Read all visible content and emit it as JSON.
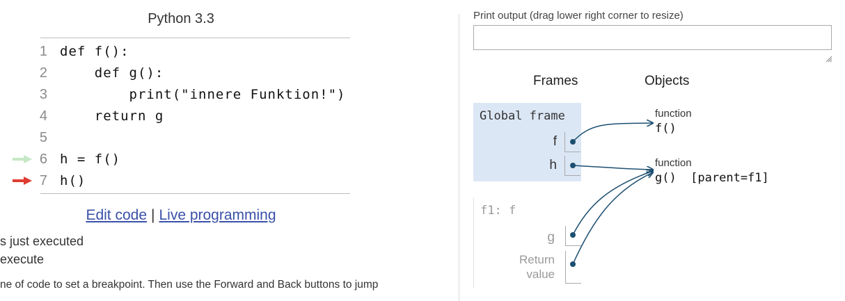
{
  "language_title": "Python 3.3",
  "code_lines": [
    {
      "num": "1",
      "text": "def f():"
    },
    {
      "num": "2",
      "text": "    def g():"
    },
    {
      "num": "3",
      "text": "        print(\"innere Funktion!\")"
    },
    {
      "num": "4",
      "text": "    return g"
    },
    {
      "num": "5",
      "text": ""
    },
    {
      "num": "6",
      "text": "h = f()"
    },
    {
      "num": "7",
      "text": "h()"
    }
  ],
  "markers": {
    "prev_line_color": "#c6e8c6",
    "next_line_color": "#e03c31"
  },
  "links": {
    "edit_code": "Edit code",
    "separator": "|",
    "live_programming": "Live programming"
  },
  "legend": {
    "just_executed": "s just executed",
    "to_execute": "execute"
  },
  "hint": "ne of code to set a breakpoint. Then use the Forward and Back buttons to jump",
  "print_output": {
    "label": "Print output (drag lower right corner to resize)",
    "value": ""
  },
  "viz": {
    "frames_header": "Frames",
    "objects_header": "Objects",
    "global_frame": {
      "title": "Global frame",
      "vars": [
        {
          "name": "f"
        },
        {
          "name": "h"
        }
      ]
    },
    "f1_frame": {
      "title": "f1: f",
      "vars": [
        {
          "name": "g"
        },
        {
          "name": "Return\nvalue"
        }
      ]
    },
    "objects": [
      {
        "type": "function",
        "value": "f()"
      },
      {
        "type": "function",
        "value": "g()  [parent=f1]"
      }
    ],
    "arrow_color": "#1d4f71"
  }
}
